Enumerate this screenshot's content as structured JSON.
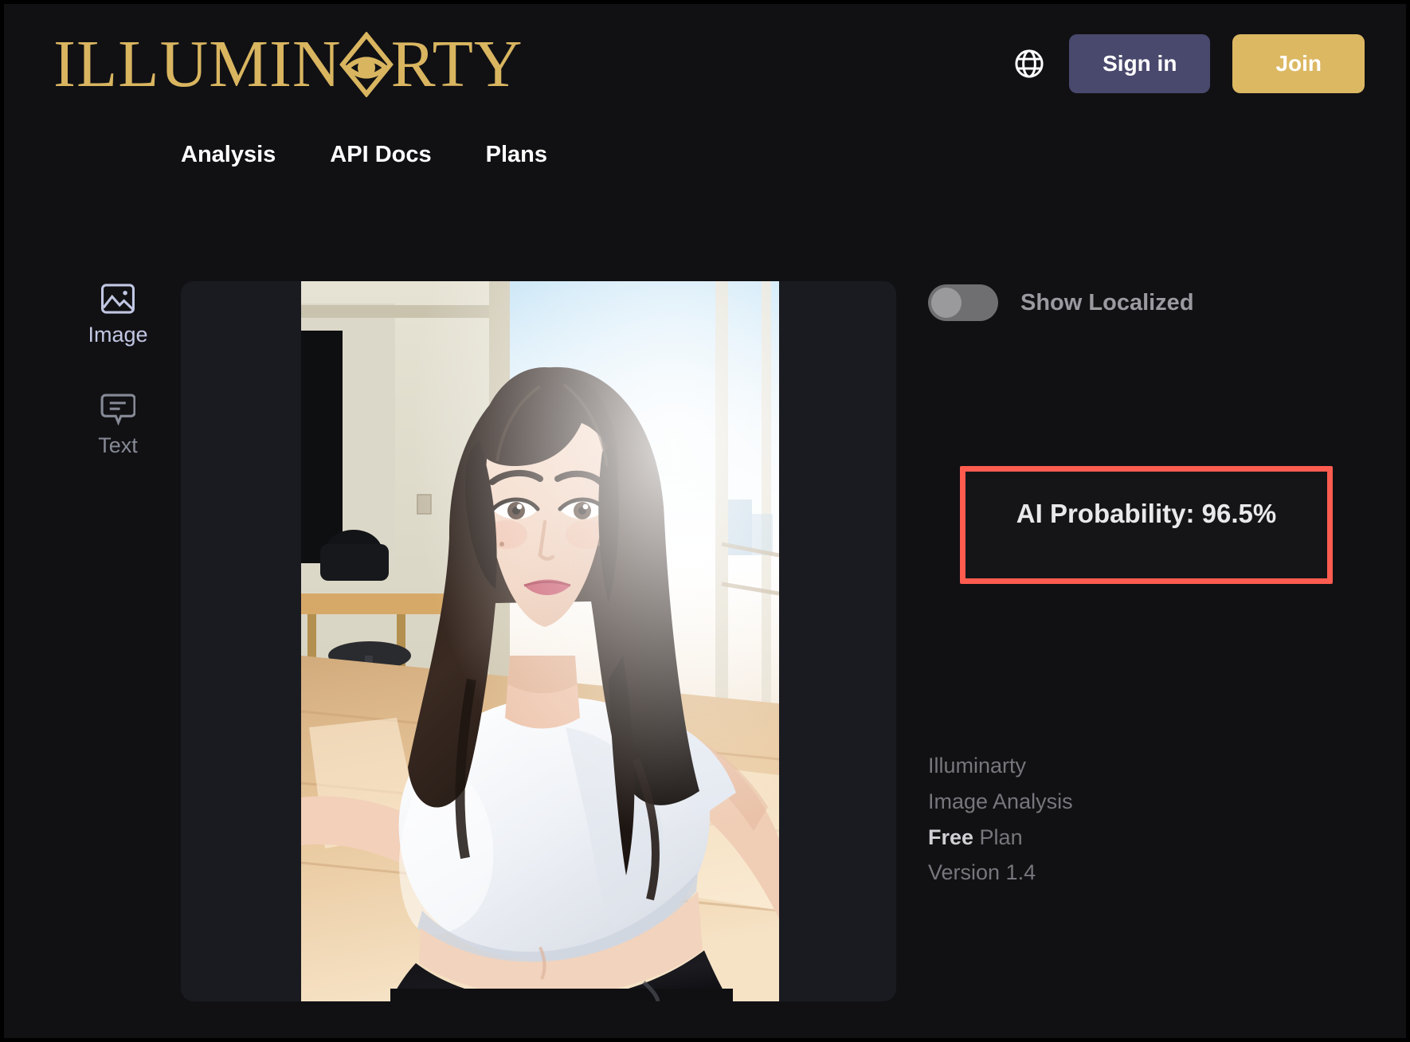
{
  "header": {
    "logo_text_before": "ILLUMIN",
    "logo_text_after": "RTY",
    "logo_icon": "eye-in-triangle-icon",
    "logo_color": "#d9b560",
    "globe_icon": "globe-icon",
    "sign_in_label": "Sign in",
    "sign_in_bg": "#49496e",
    "join_label": "Join",
    "join_bg": "#dcb863"
  },
  "nav": {
    "items": [
      {
        "label": "Analysis"
      },
      {
        "label": "API Docs"
      },
      {
        "label": "Plans"
      }
    ]
  },
  "sidebar": {
    "items": [
      {
        "label": "Image",
        "icon": "picture-icon",
        "active": true
      },
      {
        "label": "Text",
        "icon": "speech-bubble-icon",
        "active": false
      }
    ],
    "active_color": "#c2c7e3",
    "inactive_color": "#868a96"
  },
  "preview": {
    "alt": "uploaded-photo-portrait-of-woman-indoors"
  },
  "results": {
    "toggle_label": "Show Localized",
    "toggle_state": "off",
    "probability_label": "AI Probability: 96.5%",
    "probability_value": 96.5,
    "probability_border_color": "#ff5c50"
  },
  "footer": {
    "brand": "Illuminarty",
    "product": "Image Analysis",
    "plan_name": "Free",
    "plan_suffix": " Plan",
    "version": "Version 1.4"
  }
}
